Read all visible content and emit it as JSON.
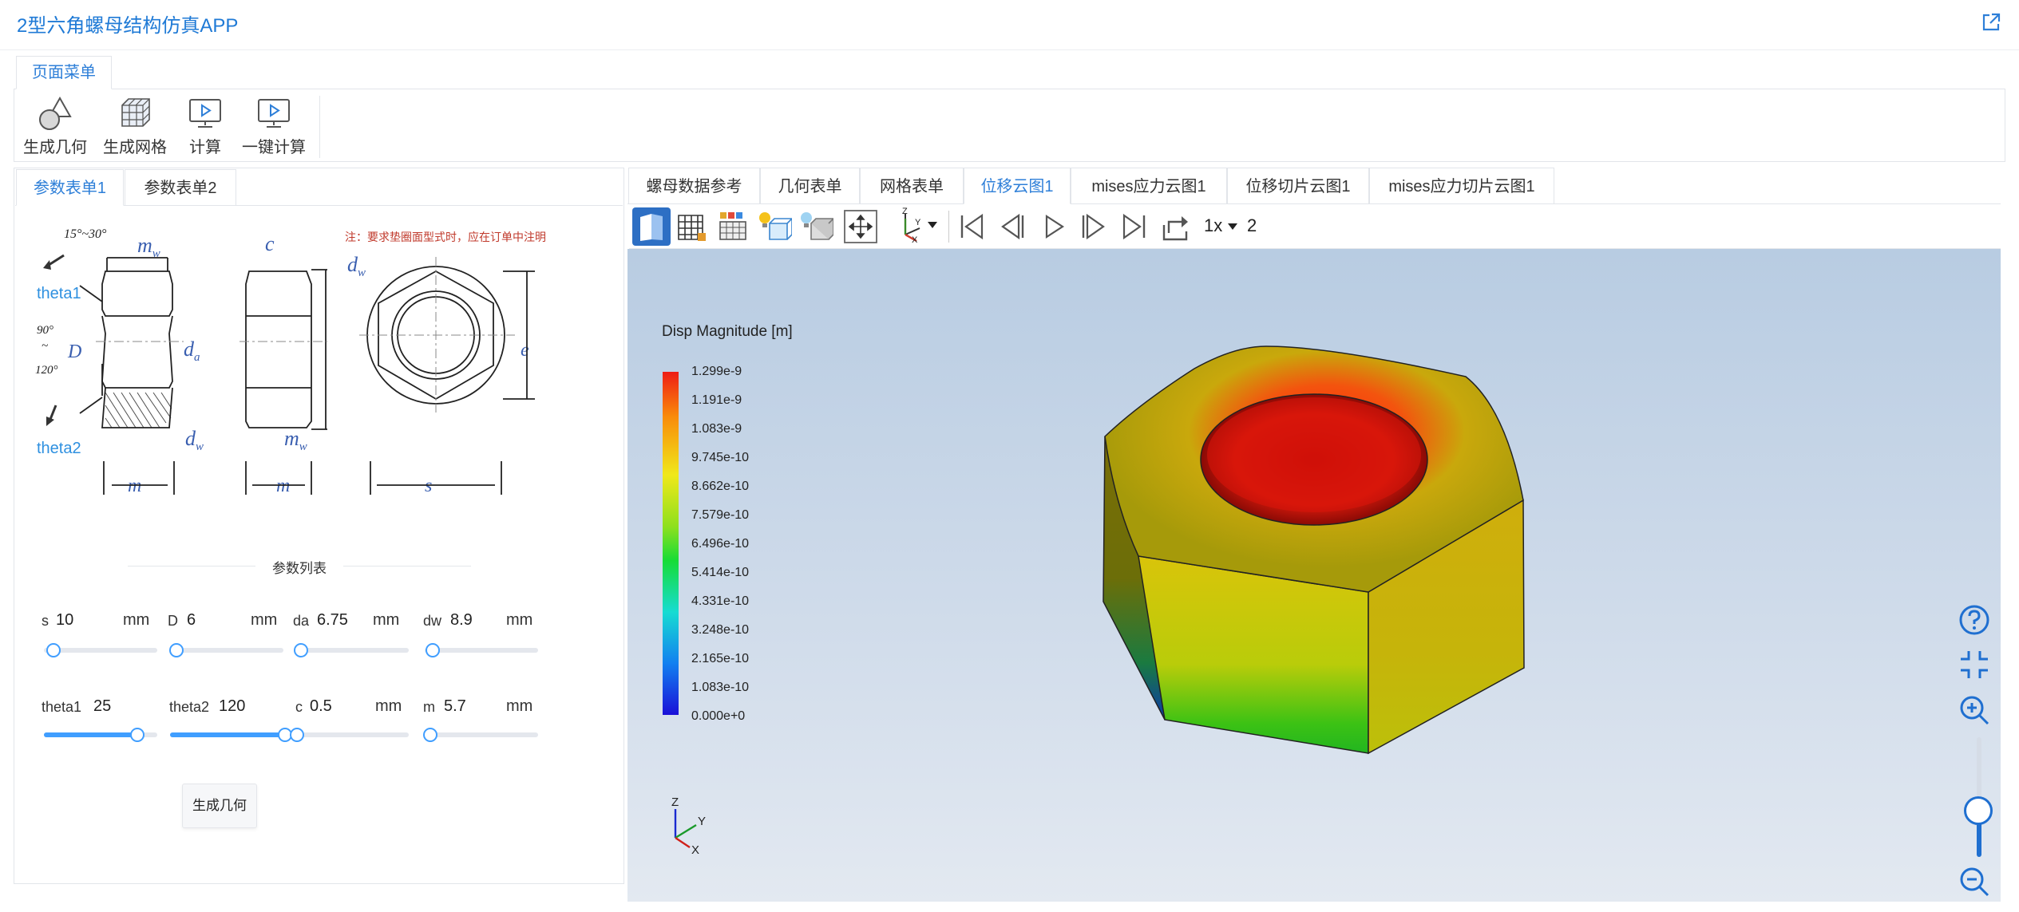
{
  "app": {
    "title": "2型六角螺母结构仿真APP"
  },
  "menu": {
    "tab": "页面菜单",
    "tools": [
      {
        "label": "生成几何",
        "icon": "geometry-icon"
      },
      {
        "label": "生成网格",
        "icon": "mesh-icon"
      },
      {
        "label": "计算",
        "icon": "compute-icon"
      },
      {
        "label": "一键计算",
        "icon": "one-click-compute-icon"
      }
    ]
  },
  "left": {
    "tabs": [
      "参数表单1",
      "参数表单2"
    ],
    "active_tab": 0,
    "diagram": {
      "angle_top": "15°~30°",
      "angle_mid_1": "90°",
      "angle_mid_2": "~",
      "angle_mid_3": "120°",
      "note": "注：要求垫圈面型式时，应在订单中注明",
      "theta1": "theta1",
      "theta2": "theta2",
      "D": "D",
      "mw": "m",
      "mw_sub": "w",
      "da": "d",
      "da_sub": "a",
      "dw": "d",
      "dw_sub": "w",
      "c": "c",
      "dw2": "d",
      "dw2_sub": "w",
      "mw2": "m",
      "mw2_sub": "w",
      "m1": "m",
      "m2": "m",
      "s": "s",
      "e": "e"
    },
    "param_title": "参数列表",
    "params": [
      {
        "label": "s",
        "value": "10",
        "unit": "mm",
        "level": 0.0
      },
      {
        "label": "D",
        "value": "6",
        "unit": "mm",
        "level": 0.0
      },
      {
        "label": "da",
        "value": "6.75",
        "unit": "mm",
        "level": 0.0
      },
      {
        "label": "dw",
        "value": "8.9",
        "unit": "mm",
        "level": 0.0
      },
      {
        "label": "theta1",
        "value": "25",
        "unit": "",
        "level": 0.83
      },
      {
        "label": "theta2",
        "value": "120",
        "unit": "",
        "level": 1.0
      },
      {
        "label": "c",
        "value": "0.5",
        "unit": "mm",
        "level": 0.0
      },
      {
        "label": "m",
        "value": "5.7",
        "unit": "mm",
        "level": 0.0
      }
    ],
    "generate_button": "生成几何"
  },
  "right": {
    "tabs": [
      "螺母数据参考",
      "几何表单",
      "网格表单",
      "位移云图1",
      "mises应力云图1",
      "位移切片云图1",
      "mises应力切片云图1"
    ],
    "active_tab": 3,
    "toolbar": {
      "speed": "1x",
      "frame": "2"
    },
    "legend": {
      "title": "Disp Magnitude [m]",
      "ticks": [
        "1.299e-9",
        "1.191e-9",
        "1.083e-9",
        "9.745e-10",
        "8.662e-10",
        "7.579e-10",
        "6.496e-10",
        "5.414e-10",
        "4.331e-10",
        "3.248e-10",
        "2.165e-10",
        "1.083e-10",
        "0.000e+0"
      ]
    },
    "axes": {
      "z": "Z",
      "y": "Y",
      "x": "X"
    },
    "side_icons": [
      "help-icon",
      "fit-view-icon",
      "zoom-in-icon",
      "zoom-out-icon"
    ],
    "zoom_level": 0.3
  }
}
